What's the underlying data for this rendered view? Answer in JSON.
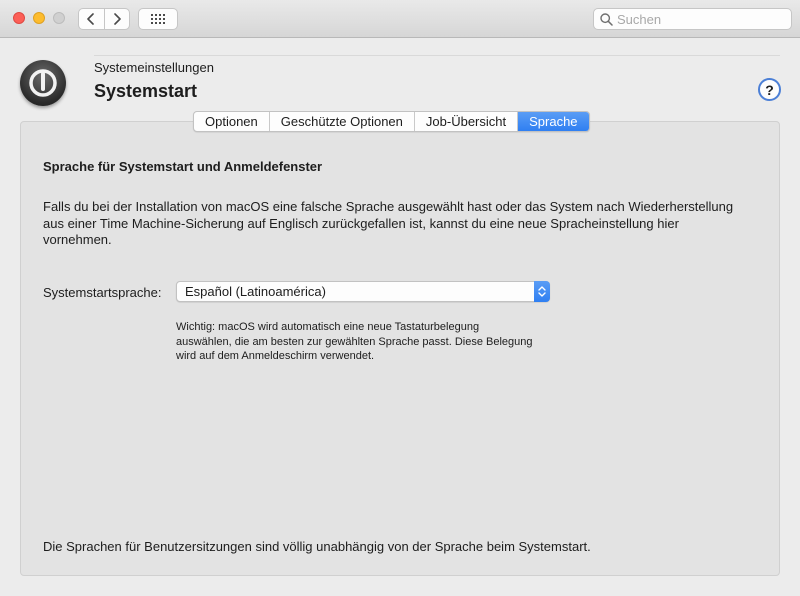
{
  "window": {
    "search_placeholder": "Suchen"
  },
  "header": {
    "breadcrumb": "Systemeinstellungen",
    "title": "Systemstart",
    "help_label": "?"
  },
  "tabs": [
    {
      "label": "Optionen",
      "active": false
    },
    {
      "label": "Geschützte Optionen",
      "active": false
    },
    {
      "label": "Job-Übersicht",
      "active": false
    },
    {
      "label": "Sprache",
      "active": true
    }
  ],
  "main": {
    "section_title": "Sprache für Systemstart und Anmeldefenster",
    "description": "Falls du bei der Installation von macOS eine falsche Sprache ausgewählt hast oder das System nach Wiederherstellung aus einer Time Machine-Sicherung auf Englisch zurückgefallen ist, kannst du eine neue Spracheinstellung hier vornehmen.",
    "language_label": "Systemstartsprache:",
    "language_value": "Español (Latinoamérica)",
    "note": "Wichtig: macOS wird automatisch eine neue Tastaturbelegung auswählen, die am besten zur gewählten Sprache passt. Diese Belegung wird auf dem Anmeldeschirm verwendet.",
    "footer": "Die Sprachen für Benutzersitzungen sind völlig unabhängig von der Sprache beim Systemstart."
  },
  "colors": {
    "accent": "#2f7ff2",
    "close": "#fc5f57",
    "minimize": "#fdbc2e",
    "zoom_disabled": "#d0d0d0"
  },
  "icons": {
    "back": "chevron-left-icon",
    "forward": "chevron-right-icon",
    "grid": "grid-icon",
    "search": "search-icon",
    "pane": "power-icon",
    "select": "up-down-arrows-icon"
  }
}
